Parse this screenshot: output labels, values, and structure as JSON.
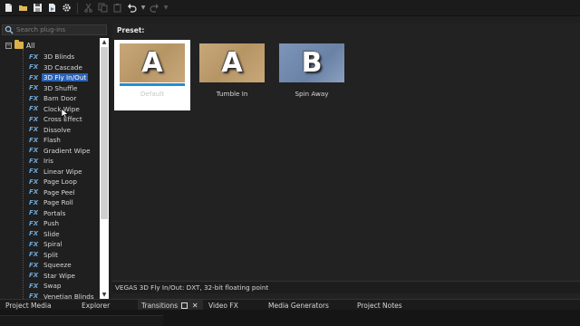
{
  "toolbar": {
    "buttons": [
      "new-icon",
      "open-folder-icon",
      "save-icon",
      "render-icon",
      "settings-icon",
      "cut-icon",
      "copy-icon",
      "paste-icon",
      "undo-icon",
      "redo-icon"
    ]
  },
  "plugin_search": {
    "placeholder": "Search plug-ins"
  },
  "tree": {
    "root_label": "All",
    "items": [
      {
        "fx": "FX",
        "label": "3D Blinds"
      },
      {
        "fx": "FX",
        "label": "3D Cascade"
      },
      {
        "fx": "FX",
        "label": "3D Fly In/Out",
        "selected": true
      },
      {
        "fx": "FX",
        "label": "3D Shuffle"
      },
      {
        "fx": "FX",
        "label": "Barn Door"
      },
      {
        "fx": "FX",
        "label": "Clock Wipe"
      },
      {
        "fx": "FX",
        "label": "Cross Effect"
      },
      {
        "fx": "FX",
        "label": "Dissolve"
      },
      {
        "fx": "FX",
        "label": "Flash"
      },
      {
        "fx": "FX",
        "label": "Gradient Wipe"
      },
      {
        "fx": "FX",
        "label": "Iris"
      },
      {
        "fx": "FX",
        "label": "Linear Wipe"
      },
      {
        "fx": "FX",
        "label": "Page Loop"
      },
      {
        "fx": "FX",
        "label": "Page Peel"
      },
      {
        "fx": "FX",
        "label": "Page Roll"
      },
      {
        "fx": "FX",
        "label": "Portals"
      },
      {
        "fx": "FX",
        "label": "Push"
      },
      {
        "fx": "FX",
        "label": "Slide"
      },
      {
        "fx": "FX",
        "label": "Spiral"
      },
      {
        "fx": "FX",
        "label": "Split"
      },
      {
        "fx": "FX",
        "label": "Squeeze"
      },
      {
        "fx": "FX",
        "label": "Star Wipe"
      },
      {
        "fx": "FX",
        "label": "Swap"
      },
      {
        "fx": "FX",
        "label": "Venetian Blinds"
      }
    ]
  },
  "presets": {
    "label": "Preset:",
    "items": [
      {
        "name": "Default",
        "letter": "A",
        "style": "tan",
        "selected": true,
        "progress": 1.0
      },
      {
        "name": "Tumble In",
        "letter": "A",
        "style": "tan",
        "selected": false
      },
      {
        "name": "Spin Away",
        "letter": "B",
        "style": "blue",
        "selected": false
      }
    ]
  },
  "description": "VEGAS 3D Fly In/Out: DXT, 32-bit floating point",
  "tabs": [
    {
      "label": "Project Media"
    },
    {
      "label": "Explorer"
    },
    {
      "label": "Transitions",
      "active": true
    },
    {
      "label": "Video FX"
    },
    {
      "label": "Media Generators"
    },
    {
      "label": "Project Notes"
    }
  ],
  "colors": {
    "selection": "#2c63b5",
    "fx_blue": "#6fa8d8",
    "folder": "#d9b24a",
    "progress": "#1f8fd6"
  }
}
